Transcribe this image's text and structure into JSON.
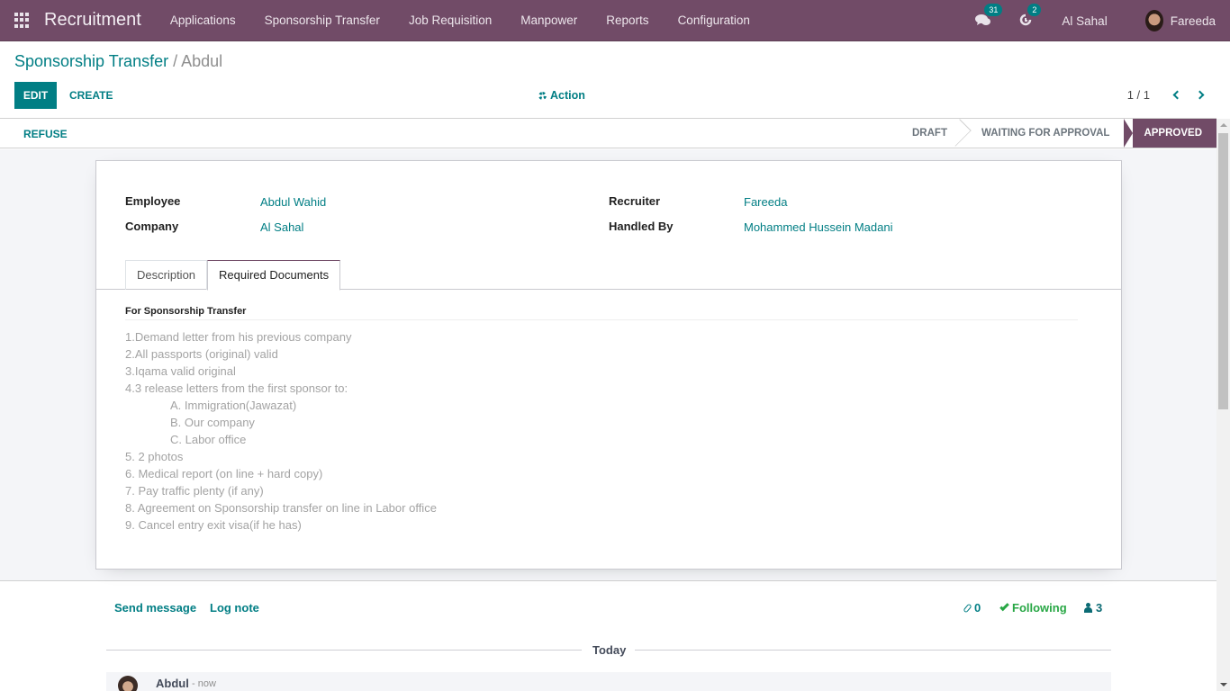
{
  "navbar": {
    "app_name": "Recruitment",
    "menu": [
      "Applications",
      "Sponsorship Transfer",
      "Job Requisition",
      "Manpower",
      "Reports",
      "Configuration"
    ],
    "messages_count": "31",
    "activities_count": "2",
    "company": "Al Sahal",
    "user": "Fareeda",
    "colors": {
      "brand": "#714b67",
      "accent": "#017e84"
    }
  },
  "breadcrumb": {
    "parent": "Sponsorship Transfer",
    "separator": "/",
    "current": "Abdul"
  },
  "toolbar": {
    "edit_label": "EDIT",
    "create_label": "CREATE",
    "action_label": "Action",
    "pager": "1 / 1"
  },
  "statusbar": {
    "refuse_label": "REFUSE",
    "stages": [
      "DRAFT",
      "WAITING FOR APPROVAL",
      "APPROVED"
    ],
    "active_stage": "APPROVED"
  },
  "form": {
    "employee_label": "Employee",
    "employee_value": "Abdul Wahid",
    "company_label": "Company",
    "company_value": "Al Sahal",
    "recruiter_label": "Recruiter",
    "recruiter_value": "Fareeda",
    "handled_by_label": "Handled By",
    "handled_by_value": "Mohammed Hussein Madani",
    "tabs": [
      "Description",
      "Required Documents"
    ],
    "active_tab": "Required Documents",
    "documents": {
      "title": "For Sponsorship Transfer",
      "lines": [
        "1.Demand letter from his previous company",
        "2.All passports (original) valid",
        "3.Iqama valid original",
        "4.3 release letters from the first sponsor to:",
        "A. Immigration(Jawazat)",
        "B. Our company",
        "C. Labor office",
        "5. 2 photos",
        "6. Medical report (on line + hard copy)",
        "7. Pay traffic plenty (if any)",
        "8. Agreement on Sponsorship transfer on line in Labor office",
        "9. Cancel entry exit visa(if he has)"
      ]
    }
  },
  "chatter": {
    "send_message": "Send message",
    "log_note": "Log note",
    "attachments": "0",
    "following": "Following",
    "followers": "3",
    "date_separator": "Today",
    "message": {
      "author": "Abdul",
      "time": "- now"
    }
  }
}
